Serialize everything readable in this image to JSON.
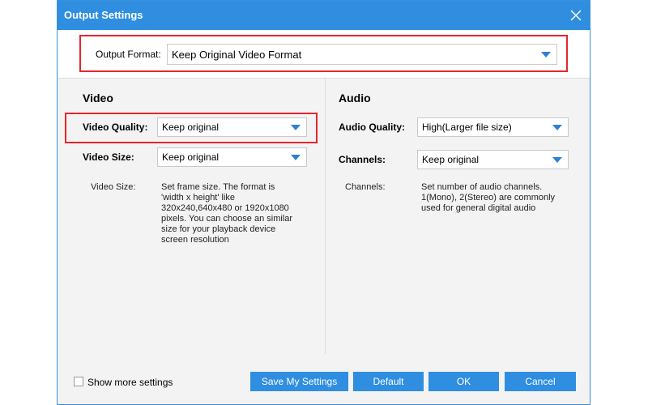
{
  "window": {
    "title": "Output Settings"
  },
  "output_format": {
    "label": "Output Format:",
    "value": "Keep Original Video Format"
  },
  "video": {
    "heading": "Video",
    "quality": {
      "label": "Video Quality:",
      "value": "Keep original"
    },
    "size": {
      "label": "Video Size:",
      "value": "Keep original"
    },
    "help": {
      "label": "Video Size:",
      "lines": [
        "Set frame size. The format is",
        "'width x height' like",
        "320x240,640x480 or 1920x1080",
        "pixels. You can choose an similar",
        "size for your playback device",
        "screen resolution"
      ]
    }
  },
  "audio": {
    "heading": "Audio",
    "quality": {
      "label": "Audio Quality:",
      "value": "High(Larger file size)"
    },
    "channels": {
      "label": "Channels:",
      "value": "Keep original"
    },
    "help": {
      "label": "Channels:",
      "lines": [
        "Set number of audio channels.",
        "1(Mono), 2(Stereo) are commonly",
        "used for general digital audio"
      ]
    }
  },
  "footer": {
    "show_more": "Show more settings",
    "buttons": {
      "save": "Save My Settings",
      "default": "Default",
      "ok": "OK",
      "cancel": "Cancel"
    }
  },
  "colors": {
    "accent": "#2f8ee0",
    "highlight": "#e4262e",
    "arrow": "#2f7fd6"
  },
  "icons": {
    "close": "close-icon",
    "dropdown": "chevron-down-icon"
  }
}
